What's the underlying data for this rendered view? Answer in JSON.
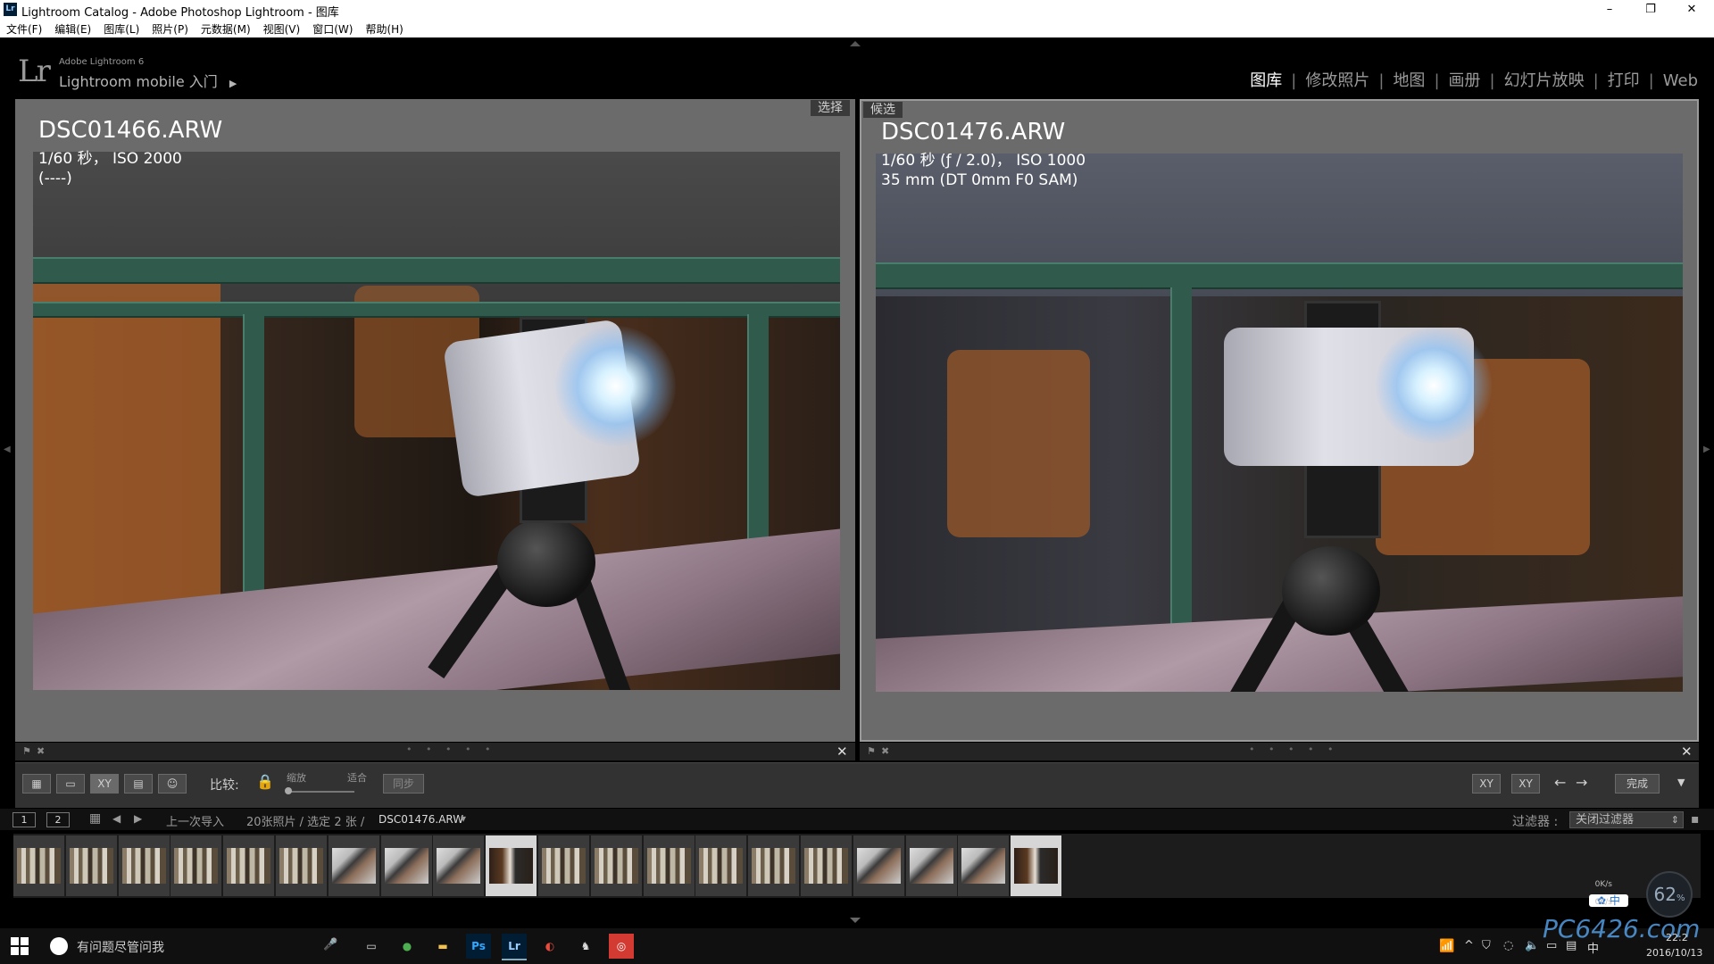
{
  "window": {
    "app_icon": "Lr",
    "title": "Lightroom Catalog - Adobe Photoshop Lightroom - 图库",
    "minimize": "–",
    "maximize": "❐",
    "close": "✕"
  },
  "menu": [
    "文件(F)",
    "编辑(E)",
    "图库(L)",
    "照片(P)",
    "元数据(M)",
    "视图(V)",
    "窗口(W)",
    "帮助(H)"
  ],
  "identity": {
    "logo": "Lr",
    "version": "Adobe Lightroom 6",
    "mobile": "Lightroom mobile 入门",
    "mobile_arrow": "▶"
  },
  "modules": [
    "图库",
    "修改照片",
    "地图",
    "画册",
    "幻灯片放映",
    "打印",
    "Web"
  ],
  "active_module": "图库",
  "module_separator": "|",
  "left_pane": {
    "tag": "选择",
    "filename": "DSC01466.ARW",
    "meta1": "1/60 秒， ISO 2000",
    "meta2": "(----)"
  },
  "right_pane": {
    "tag": "候选",
    "filename": "DSC01476.ARW",
    "meta1": "1/60 秒 (ƒ / 2.0)， ISO 1000",
    "meta2": "35 mm (DT 0mm F0 SAM)"
  },
  "pane_footer": {
    "flag": "⚑",
    "reject": "✖",
    "dots": "• • • • •",
    "close": "✕"
  },
  "toolbar": {
    "grid_icon": "▦",
    "loupe_icon": "▭",
    "compare_label": "XY",
    "survey_icon": "▤",
    "people_icon": "☺",
    "compare_text": "比较:",
    "lock_icon": "🔒",
    "zoom_label": "缩放",
    "fit_label": "适合",
    "sync_label": "同步",
    "swap_label": "XY",
    "select_label": "XY",
    "prev": "←",
    "next": "→",
    "done_label": "完成",
    "menu": "▼"
  },
  "filmstrip_header": {
    "screen1": "1",
    "screen2": "2",
    "grid": "▦",
    "back": "◀",
    "forward": "▶",
    "source": "上一次导入",
    "count": "20张照片 / 选定 2 张 /",
    "current_file": "DSC01476.ARW",
    "dropdown": "▾",
    "filter_label": "过滤器 :",
    "filter_value": "关闭过滤器",
    "filter_arrow": "⇕",
    "lock": "▪"
  },
  "filmstrip": [
    {
      "style": "t-a",
      "selected": false
    },
    {
      "style": "t-a",
      "selected": false
    },
    {
      "style": "t-a",
      "selected": false
    },
    {
      "style": "t-a",
      "selected": false
    },
    {
      "style": "t-a",
      "selected": false
    },
    {
      "style": "t-a",
      "selected": false
    },
    {
      "style": "t-b",
      "selected": false
    },
    {
      "style": "t-b",
      "selected": false
    },
    {
      "style": "t-b",
      "selected": false
    },
    {
      "style": "t-c",
      "selected": true
    },
    {
      "style": "t-a",
      "selected": false
    },
    {
      "style": "t-a",
      "selected": false
    },
    {
      "style": "t-a",
      "selected": false
    },
    {
      "style": "t-a",
      "selected": false
    },
    {
      "style": "t-a",
      "selected": false
    },
    {
      "style": "t-a",
      "selected": false
    },
    {
      "style": "t-b",
      "selected": false
    },
    {
      "style": "t-b",
      "selected": false
    },
    {
      "style": "t-b",
      "selected": false
    },
    {
      "style": "t-c",
      "selected": true
    }
  ],
  "taskbar": {
    "search": "有问题尽管问我",
    "mic": "🎤",
    "apps": [
      {
        "name": "task-view",
        "label": "▭",
        "bg": "#101010",
        "fg": "#ddd"
      },
      {
        "name": "chrome",
        "label": "●",
        "bg": "#101010",
        "fg": "#4caf50"
      },
      {
        "name": "explorer",
        "label": "▬",
        "bg": "#101010",
        "fg": "#f2c14e"
      },
      {
        "name": "photoshop",
        "label": "Ps",
        "bg": "#001d34",
        "fg": "#31a8ff"
      },
      {
        "name": "lightroom",
        "label": "Lr",
        "bg": "#001d34",
        "fg": "#9ccfff"
      },
      {
        "name": "app-red",
        "label": "◐",
        "bg": "#101010",
        "fg": "#e84c3d"
      },
      {
        "name": "app-fox",
        "label": "♞",
        "bg": "#101010",
        "fg": "#ddd"
      },
      {
        "name": "netease-music",
        "label": "◎",
        "bg": "#d33a31",
        "fg": "#fff"
      }
    ],
    "ime": "中",
    "net_up": "0K/s",
    "net_down": "0K/s",
    "cpu": "62",
    "cpu_unit": "%",
    "watermark": "PC6426.com",
    "date": "2016/10/13",
    "time": "22:2"
  },
  "colors": {
    "pane_bg": "#6b6b6b",
    "active_module": "#ffffff",
    "inactive_module": "#9a9a9a"
  }
}
